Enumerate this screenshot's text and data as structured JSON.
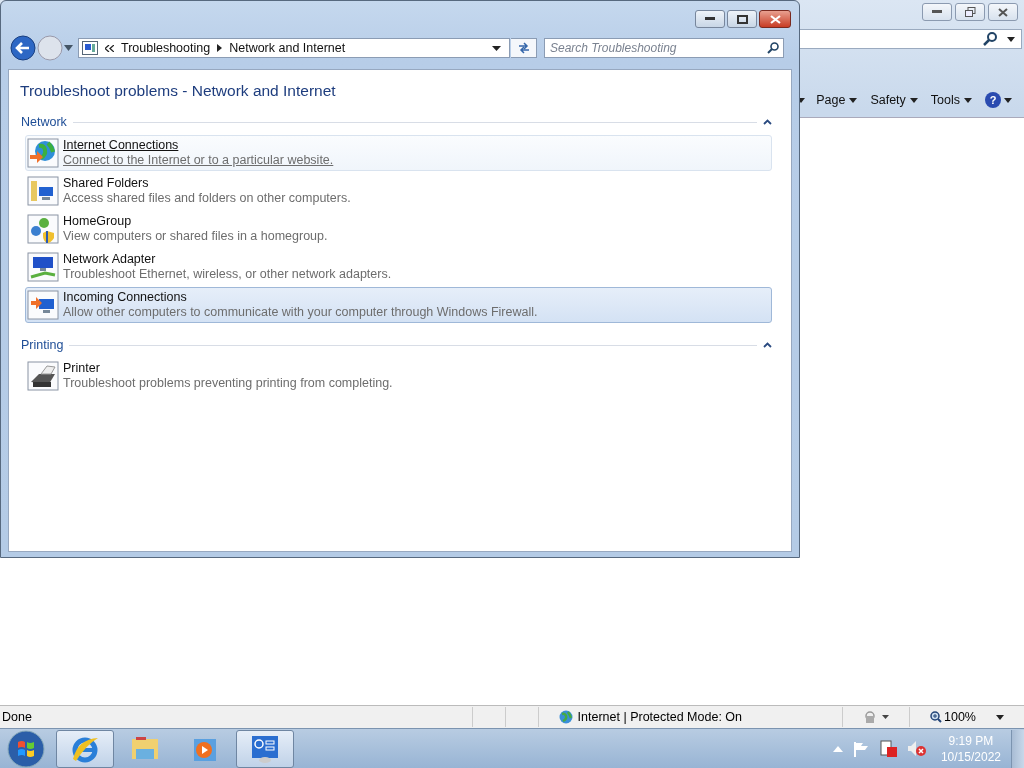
{
  "explorer": {
    "breadcrumb": [
      "Troubleshooting",
      "Network and Internet"
    ],
    "search": {
      "placeholder": "Search Troubleshooting"
    },
    "heading": "Troubleshoot problems - Network and Internet",
    "groups": [
      {
        "title": "Network",
        "expanded": true,
        "items": [
          {
            "kind": "globe",
            "title": "Internet Connections",
            "description": "Connect to the Internet or to a particular website.",
            "hovered": true,
            "selected": false
          },
          {
            "kind": "folder",
            "title": "Shared Folders",
            "description": "Access shared files and folders on other computers.",
            "hovered": false,
            "selected": false
          },
          {
            "kind": "homegroup",
            "title": "HomeGroup",
            "description": "View computers or shared files in a homegroup.",
            "hovered": false,
            "selected": false
          },
          {
            "kind": "adapter",
            "title": "Network Adapter",
            "description": "Troubleshoot Ethernet, wireless, or other network adapters.",
            "hovered": false,
            "selected": false
          },
          {
            "kind": "incoming",
            "title": "Incoming Connections",
            "description": "Allow other computers to communicate with your computer through Windows Firewall.",
            "hovered": false,
            "selected": true
          }
        ]
      },
      {
        "title": "Printing",
        "expanded": true,
        "items": [
          {
            "kind": "printer",
            "title": "Printer",
            "description": "Troubleshoot problems preventing printing from completing.",
            "hovered": false,
            "selected": false
          }
        ]
      }
    ]
  },
  "browser": {
    "commands": [
      "Page",
      "Safety",
      "Tools"
    ],
    "help_glyph": "?",
    "status": "Done",
    "zone": "Internet | Protected Mode: On",
    "zoom": "100%"
  },
  "taskbar": {
    "apps": [
      {
        "kind": "ie",
        "active": true
      },
      {
        "kind": "explorer",
        "active": false
      },
      {
        "kind": "media",
        "active": false
      },
      {
        "kind": "control",
        "active": true
      }
    ],
    "time": "9:19 PM",
    "date": "10/15/2022"
  }
}
